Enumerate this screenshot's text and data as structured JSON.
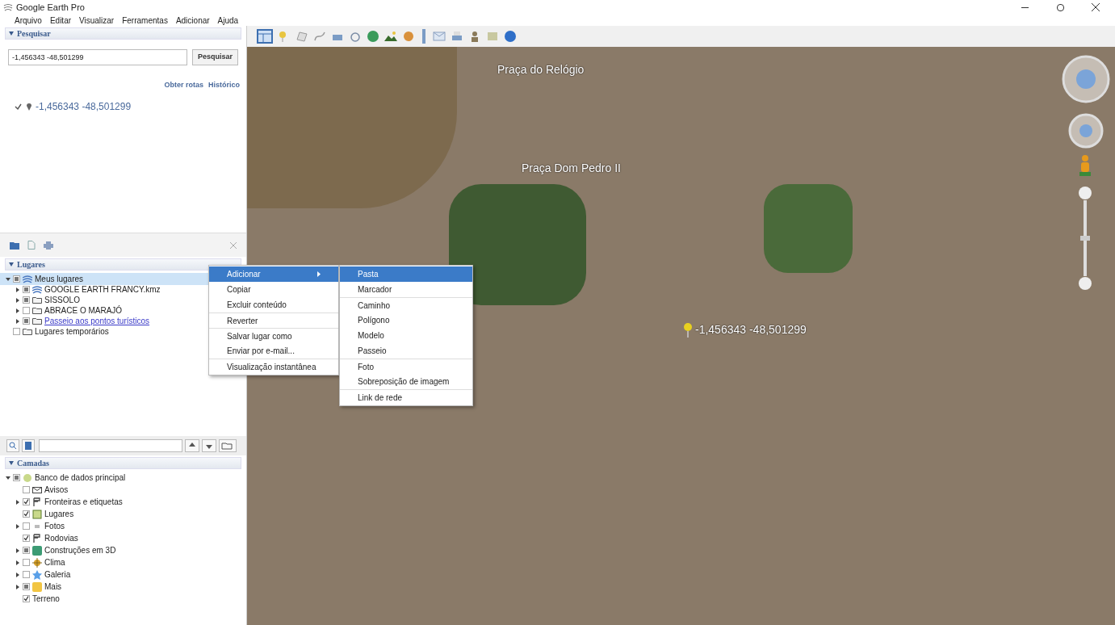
{
  "window": {
    "title": "Google Earth Pro"
  },
  "menu": [
    {
      "label": "Arquivo"
    },
    {
      "label": "Editar"
    },
    {
      "label": "Visualizar"
    },
    {
      "label": "Ferramentas"
    },
    {
      "label": "Adicionar"
    },
    {
      "label": "Ajuda"
    }
  ],
  "search": {
    "header": "Pesquisar",
    "expanded": true,
    "value": "-1,456343 -48,501299",
    "button": "Pesquisar",
    "links": [
      "Obter rotas",
      "Histórico"
    ],
    "results": [
      {
        "text": "-1,456343 -48,501299",
        "checked": true
      }
    ]
  },
  "places": {
    "header": "Lugares",
    "expanded": true,
    "items": [
      {
        "label": "Meus lugares",
        "kind": "earth",
        "mixed": true,
        "expanded": true,
        "selected": true,
        "children": [
          {
            "label": "GOOGLE EARTH FRANCY.kmz",
            "kind": "earth",
            "mixed": true,
            "expanded": false,
            "selected": false
          },
          {
            "label": "SISSOLO",
            "kind": "folder",
            "mixed": true,
            "expanded": false,
            "selected": false
          },
          {
            "label": "ABRACE O MARAJÓ",
            "kind": "folder",
            "checked": false,
            "expanded": false,
            "selected": false
          },
          {
            "label": "Passeio aos pontos turísticos",
            "kind": "link",
            "mixed": true,
            "expanded": false,
            "selected": false
          }
        ]
      },
      {
        "label": "Lugares temporários",
        "kind": "folder",
        "checked": false,
        "selected": false
      }
    ]
  },
  "layers": {
    "header": "Camadas",
    "expanded": true,
    "items": [
      {
        "label": "Banco de dados principal",
        "kind": "database",
        "mixed": true,
        "expanded": true,
        "children": [
          {
            "label": "Avisos",
            "kind": "mail",
            "checked": false
          },
          {
            "label": "Fronteiras e etiquetas",
            "kind": "flag",
            "checked": true,
            "expanded": false
          },
          {
            "label": "Lugares",
            "kind": "square",
            "checked": true
          },
          {
            "label": "Fotos",
            "kind": "photo",
            "checked": false,
            "expanded": false
          },
          {
            "label": "Rodovias",
            "kind": "flag",
            "checked": true
          },
          {
            "label": "Construções em 3D",
            "kind": "building",
            "mixed": true,
            "expanded": false
          },
          {
            "label": "Clima",
            "kind": "sun",
            "checked": false,
            "expanded": false
          },
          {
            "label": "Galeria",
            "kind": "star",
            "checked": false,
            "expanded": false
          },
          {
            "label": "Mais",
            "kind": "note",
            "mixed": true,
            "expanded": false
          },
          {
            "label": "Terreno",
            "kind": "none",
            "checked": true
          }
        ]
      }
    ]
  },
  "context_menu": {
    "items": [
      {
        "label": "Adicionar",
        "selected": true,
        "submenu": true,
        "separator_before": false
      },
      {
        "label": "Copiar",
        "selected": false,
        "submenu": false,
        "separator_before": false
      },
      {
        "label": "Excluir conteúdo",
        "selected": false,
        "submenu": false,
        "separator_before": false
      },
      {
        "label": "Reverter",
        "selected": false,
        "submenu": false,
        "separator_before": true
      },
      {
        "label": "Salvar lugar como",
        "selected": false,
        "submenu": false,
        "separator_before": true
      },
      {
        "label": "Enviar por e-mail...",
        "selected": false,
        "submenu": false,
        "separator_before": false
      },
      {
        "label": "Visualização instantânea",
        "selected": false,
        "submenu": false,
        "separator_before": true
      }
    ],
    "submenu": [
      {
        "label": "Pasta",
        "selected": true,
        "separator_before": false
      },
      {
        "label": "Marcador",
        "selected": false,
        "separator_before": false
      },
      {
        "label": "Caminho",
        "selected": false,
        "separator_before": true
      },
      {
        "label": "Polígono",
        "selected": false,
        "separator_before": false
      },
      {
        "label": "Modelo",
        "selected": false,
        "separator_before": false
      },
      {
        "label": "Passeio",
        "selected": false,
        "separator_before": false
      },
      {
        "label": "Foto",
        "selected": false,
        "separator_before": true
      },
      {
        "label": "Sobreposição de imagem",
        "selected": false,
        "separator_before": false
      },
      {
        "label": "Link de rede",
        "selected": false,
        "separator_before": true
      }
    ]
  },
  "map": {
    "labels": [
      {
        "text": "Praça do Relógio",
        "kind": "place"
      },
      {
        "text": "Praça Dom Pedro II",
        "kind": "place"
      },
      {
        "text": "-1,456343 -48,501299",
        "kind": "pin"
      }
    ]
  }
}
